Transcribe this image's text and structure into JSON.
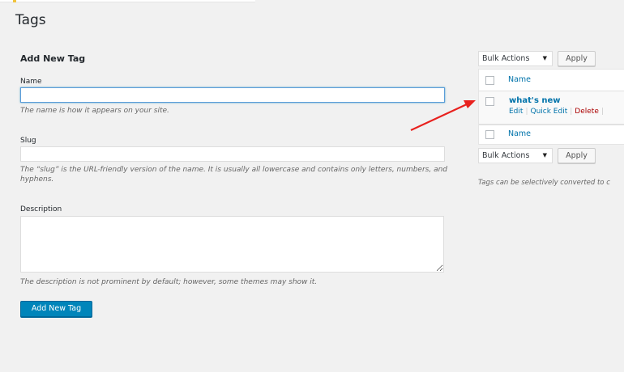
{
  "page": {
    "title": "Tags"
  },
  "form": {
    "heading": "Add New Tag",
    "name_label": "Name",
    "name_value": "",
    "name_help": "The name is how it appears on your site.",
    "slug_label": "Slug",
    "slug_value": "",
    "slug_help": "The “slug” is the URL-friendly version of the name. It is usually all lowercase and contains only letters, numbers, and hyphens.",
    "description_label": "Description",
    "description_value": "",
    "description_help": "The description is not prominent by default; however, some themes may show it.",
    "submit_label": "Add New Tag"
  },
  "table": {
    "bulk_actions_top": "Bulk Actions",
    "apply_top": "Apply",
    "column_header": "Name",
    "rows": [
      {
        "name": "what's new",
        "actions": {
          "edit": "Edit",
          "quick_edit": "Quick Edit",
          "delete": "Delete"
        }
      }
    ],
    "column_footer": "Name",
    "bulk_actions_bottom": "Bulk Actions",
    "apply_bottom": "Apply",
    "note": "Tags can be selectively converted to c"
  },
  "icons": {
    "caret": "chevron-down-icon",
    "arrow": "red-arrow-annotation"
  },
  "colors": {
    "primary": "#0085ba",
    "link": "#0073aa",
    "delete": "#aa0000",
    "arrow": "#e8211e"
  }
}
